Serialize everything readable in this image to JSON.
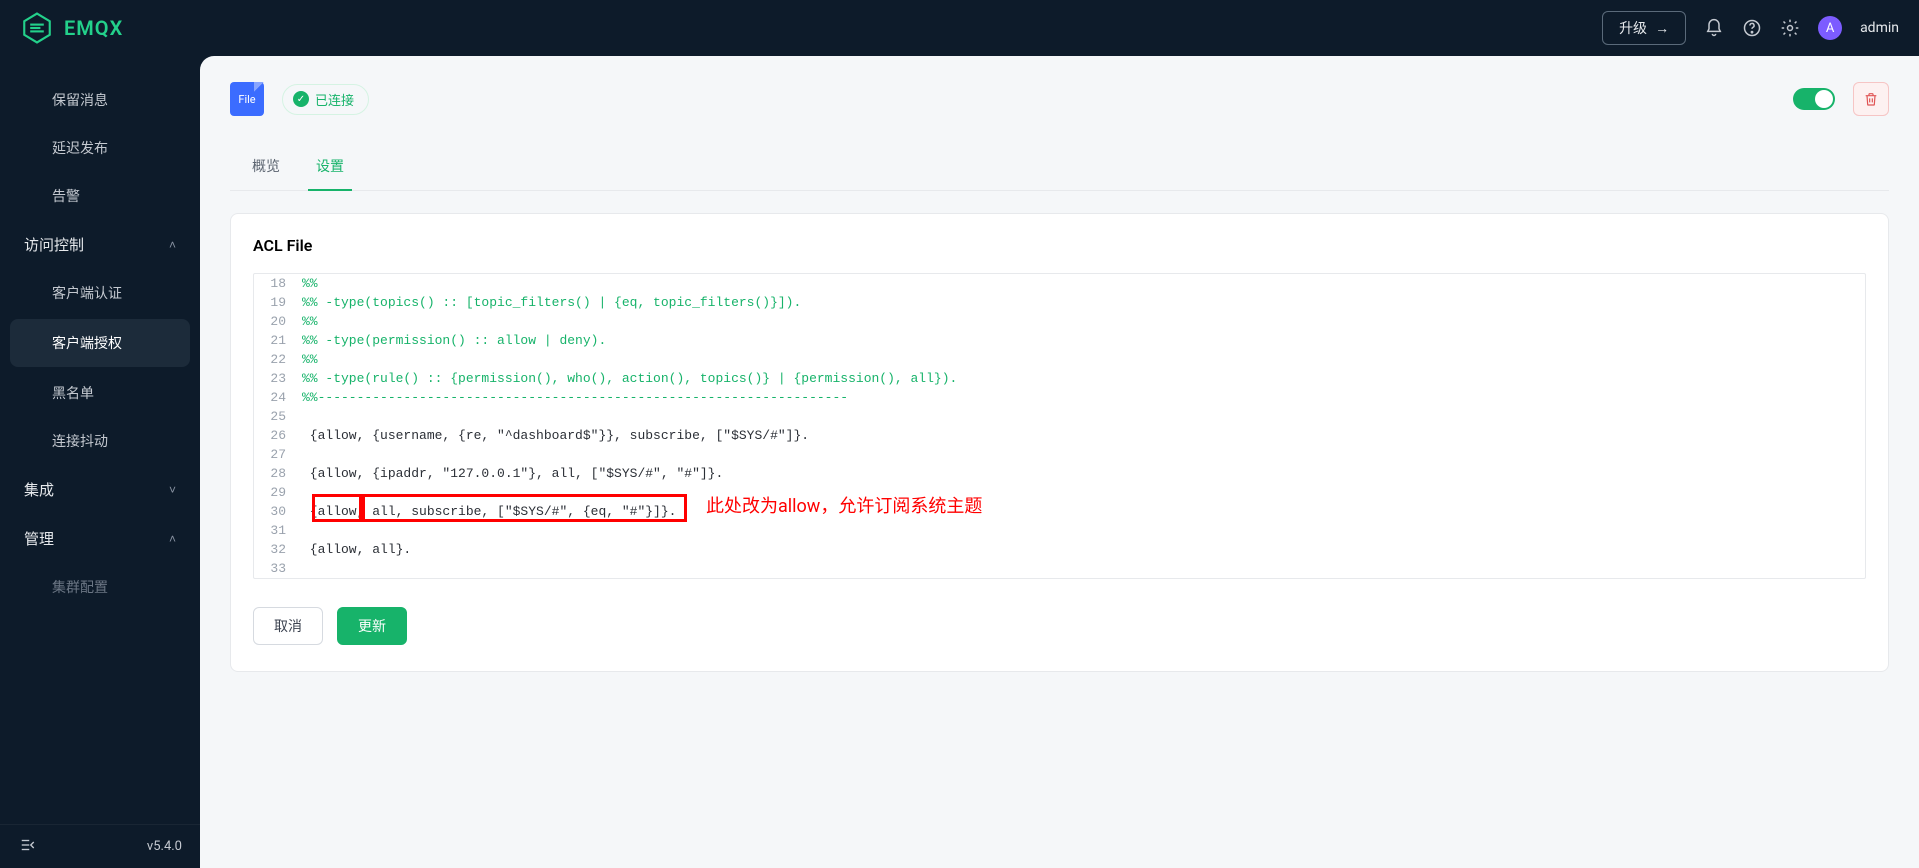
{
  "brand": {
    "name": "EMQX"
  },
  "topbar": {
    "upgrade_label": "升级",
    "username": "admin",
    "avatar_initial": "A"
  },
  "sidebar": {
    "items": [
      {
        "kind": "child",
        "label": "保留消息"
      },
      {
        "kind": "child",
        "label": "延迟发布"
      },
      {
        "kind": "child",
        "label": "告警"
      },
      {
        "kind": "section",
        "label": "访问控制",
        "expanded": true
      },
      {
        "kind": "child",
        "label": "客户端认证"
      },
      {
        "kind": "child",
        "label": "客户端授权",
        "active": true
      },
      {
        "kind": "child",
        "label": "黑名单"
      },
      {
        "kind": "child",
        "label": "连接抖动"
      },
      {
        "kind": "section",
        "label": "集成",
        "expanded": false
      },
      {
        "kind": "section",
        "label": "管理",
        "expanded": true
      },
      {
        "kind": "child",
        "label": "集群配置",
        "dim": true
      }
    ],
    "version": "v5.4.0"
  },
  "page": {
    "file_badge": "File",
    "connection_status": "已连接",
    "tabs": [
      {
        "label": "概览",
        "active": false
      },
      {
        "label": "设置",
        "active": true
      }
    ],
    "editor_title": "ACL File",
    "buttons": {
      "cancel": "取消",
      "update": "更新"
    },
    "annotation_text": "此处改为allow，允许订阅系统主题",
    "code_lines": [
      {
        "n": 18,
        "text": "%%",
        "comment": true
      },
      {
        "n": 19,
        "text": "%% -type(topics() :: [topic_filters() | {eq, topic_filters()}]).",
        "comment": true
      },
      {
        "n": 20,
        "text": "%%",
        "comment": true
      },
      {
        "n": 21,
        "text": "%% -type(permission() :: allow | deny).",
        "comment": true
      },
      {
        "n": 22,
        "text": "%%",
        "comment": true
      },
      {
        "n": 23,
        "text": "%% -type(rule() :: {permission(), who(), action(), topics()} | {permission(), all}).",
        "comment": true
      },
      {
        "n": 24,
        "text": "%%--------------------------------------------------------------------",
        "comment": true
      },
      {
        "n": 25,
        "text": "",
        "comment": false
      },
      {
        "n": 26,
        "text": " {allow, {username, {re, \"^dashboard$\"}}, subscribe, [\"$SYS/#\"]}.",
        "comment": false
      },
      {
        "n": 27,
        "text": "",
        "comment": false
      },
      {
        "n": 28,
        "text": " {allow, {ipaddr, \"127.0.0.1\"}, all, [\"$SYS/#\", \"#\"]}.",
        "comment": false
      },
      {
        "n": 29,
        "text": "",
        "comment": false
      },
      {
        "n": 30,
        "text": " {allow, all, subscribe, [\"$SYS/#\", {eq, \"#\"}]}.",
        "comment": false
      },
      {
        "n": 31,
        "text": "",
        "comment": false
      },
      {
        "n": 32,
        "text": " {allow, all}.",
        "comment": false
      },
      {
        "n": 33,
        "text": "",
        "comment": false
      }
    ]
  }
}
